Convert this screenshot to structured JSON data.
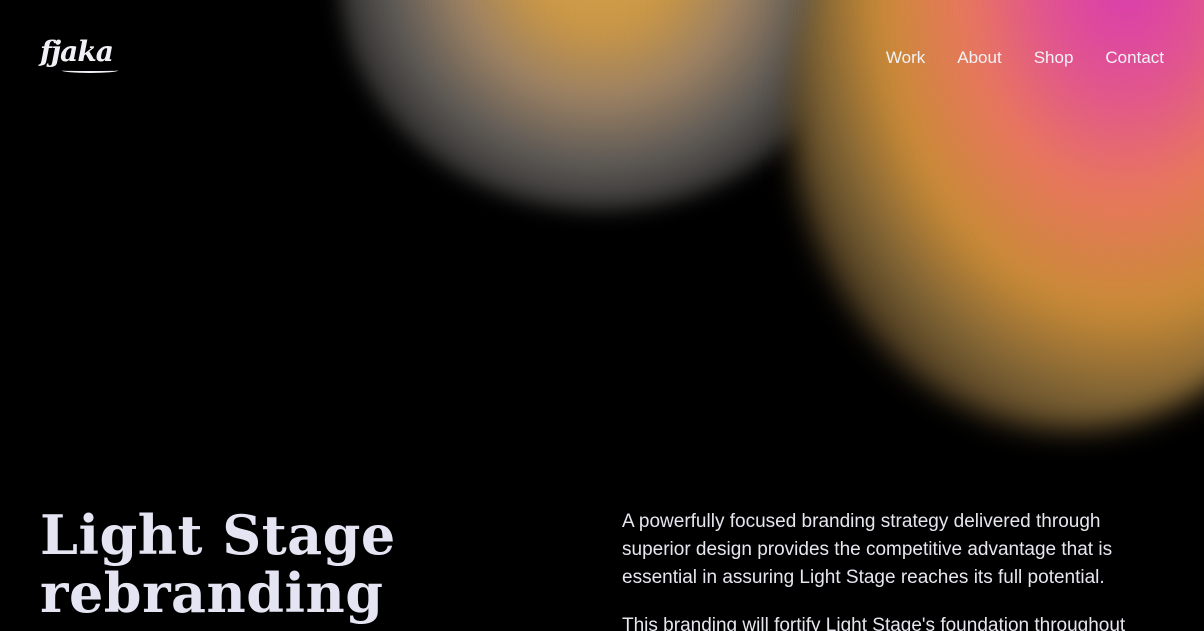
{
  "brand": {
    "logo_text": "fjaka"
  },
  "nav": {
    "items": [
      "Work",
      "About",
      "Shop",
      "Contact"
    ]
  },
  "hero": {
    "title_line1": "Light Stage",
    "title_line2": "rebranding",
    "paragraph1": "A powerfully focused branding strategy delivered through superior design provides the competitive advantage that is essential in assuring Light Stage reaches its full potential.",
    "paragraph2": "This branding will fortify Light Stage's foundation throughout"
  },
  "colors": {
    "background": "#000000",
    "text": "#e6e6ee",
    "glow_gold": "#d7a64a",
    "glow_magenta": "#d93ab0",
    "glow_coral": "#e8765c"
  }
}
